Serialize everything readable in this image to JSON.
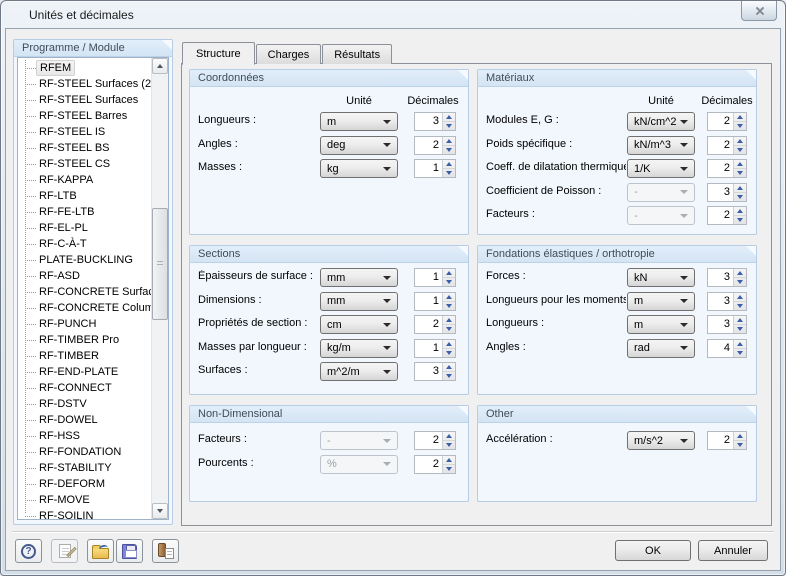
{
  "window": {
    "title": "Unités et décimales"
  },
  "module_panel": {
    "caption": "Programme / Module",
    "items": [
      {
        "label": "RFEM",
        "selected": true
      },
      {
        "label": "RF-STEEL Surfaces (2"
      },
      {
        "label": "RF-STEEL Surfaces"
      },
      {
        "label": "RF-STEEL Barres"
      },
      {
        "label": "RF-STEEL IS"
      },
      {
        "label": "RF-STEEL BS"
      },
      {
        "label": "RF-STEEL CS"
      },
      {
        "label": "RF-KAPPA"
      },
      {
        "label": "RF-LTB"
      },
      {
        "label": "RF-FE-LTB"
      },
      {
        "label": "RF-EL-PL"
      },
      {
        "label": "RF-C-À-T"
      },
      {
        "label": "PLATE-BUCKLING"
      },
      {
        "label": "RF-ASD"
      },
      {
        "label": "RF-CONCRETE Surfac"
      },
      {
        "label": "RF-CONCRETE Colum"
      },
      {
        "label": "RF-PUNCH"
      },
      {
        "label": "RF-TIMBER Pro"
      },
      {
        "label": "RF-TIMBER"
      },
      {
        "label": "RF-END-PLATE"
      },
      {
        "label": "RF-CONNECT"
      },
      {
        "label": "RF-DSTV"
      },
      {
        "label": "RF-DOWEL"
      },
      {
        "label": "RF-HSS"
      },
      {
        "label": "RF-FONDATION"
      },
      {
        "label": "RF-STABILITY"
      },
      {
        "label": "RF-DEFORM"
      },
      {
        "label": "RF-MOVE"
      },
      {
        "label": "RF-SOILIN"
      }
    ]
  },
  "tabs": [
    {
      "label": "Structure",
      "active": true
    },
    {
      "label": "Charges",
      "active": false
    },
    {
      "label": "Résultats",
      "active": false
    }
  ],
  "groups": [
    {
      "id": "coordonnees",
      "title": "Coordonnées",
      "col_unit": "Unité",
      "col_dec": "Décimales",
      "rows": [
        {
          "label": "Longueurs :",
          "unit": "m",
          "dec": "3",
          "enabled": true
        },
        {
          "label": "Angles :",
          "unit": "deg",
          "dec": "2",
          "enabled": true
        },
        {
          "label": "Masses :",
          "unit": "kg",
          "dec": "1",
          "enabled": true
        }
      ]
    },
    {
      "id": "materiaux",
      "title": "Matériaux",
      "col_unit": "Unité",
      "col_dec": "Décimales",
      "rows": [
        {
          "label": "Modules E, G :",
          "unit": "kN/cm^2",
          "dec": "2",
          "enabled": true
        },
        {
          "label": "Poids spécifique :",
          "unit": "kN/m^3",
          "dec": "2",
          "enabled": true
        },
        {
          "label": "Coeff. de dilatation thermique :",
          "unit": "1/K",
          "dec": "2",
          "enabled": true
        },
        {
          "label": "Coefficient de Poisson :",
          "unit": "-",
          "dec": "3",
          "enabled": false
        },
        {
          "label": "Facteurs :",
          "unit": "-",
          "dec": "2",
          "enabled": false
        }
      ]
    },
    {
      "id": "sections",
      "title": "Sections",
      "rows": [
        {
          "label": "Épaisseurs de surface :",
          "unit": "mm",
          "dec": "1",
          "enabled": true
        },
        {
          "label": "Dimensions :",
          "unit": "mm",
          "dec": "1",
          "enabled": true
        },
        {
          "label": "Propriétés de section :",
          "unit": "cm",
          "dec": "2",
          "enabled": true
        },
        {
          "label": "Masses par longueur :",
          "unit": "kg/m",
          "dec": "1",
          "enabled": true
        },
        {
          "label": "Surfaces :",
          "unit": "m^2/m",
          "dec": "3",
          "enabled": true
        }
      ]
    },
    {
      "id": "fondations",
      "title": "Fondations élastiques / orthotropie",
      "rows": [
        {
          "label": "Forces :",
          "unit": "kN",
          "dec": "3",
          "enabled": true
        },
        {
          "label": "Longueurs pour les moments :",
          "unit": "m",
          "dec": "3",
          "enabled": true
        },
        {
          "label": "Longueurs :",
          "unit": "m",
          "dec": "3",
          "enabled": true
        },
        {
          "label": "Angles :",
          "unit": "rad",
          "dec": "4",
          "enabled": true
        }
      ]
    },
    {
      "id": "nondim",
      "title": "Non-Dimensional",
      "rows": [
        {
          "label": "Facteurs :",
          "unit": "-",
          "dec": "2",
          "enabled": false
        },
        {
          "label": "Pourcents :",
          "unit": "%",
          "dec": "2",
          "enabled": false
        }
      ]
    },
    {
      "id": "other",
      "title": "Other",
      "rows": [
        {
          "label": "Accélération :",
          "unit": "m/s^2",
          "dec": "2",
          "enabled": true
        }
      ]
    }
  ],
  "footer": {
    "ok": "OK",
    "cancel": "Annuler",
    "icons": [
      "help-icon",
      "edit-comment-icon",
      "open-folder-icon",
      "save-icon",
      "set-default-icon"
    ]
  },
  "colors": {
    "caption_bg": "#d8e7f6",
    "caption_text": "#3f4c59",
    "group_body": "#f1f7fd",
    "group_border": "#b7cde5",
    "spin_arrow": "#3b5fa8",
    "dialog_bg": "#f0f0f0"
  }
}
